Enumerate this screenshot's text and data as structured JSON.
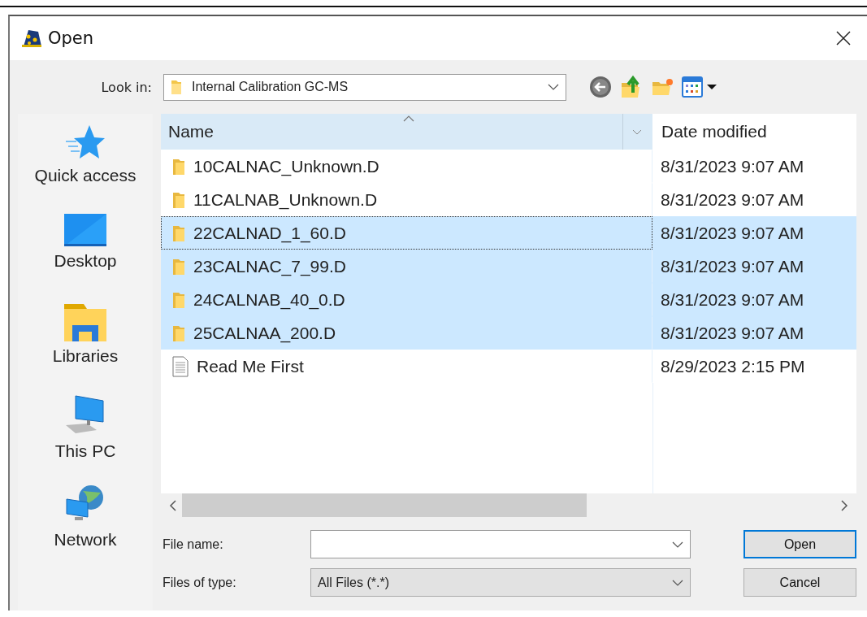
{
  "window": {
    "title": "Open"
  },
  "look_in": {
    "label": "Look in:",
    "value": "Internal Calibration GC-MS"
  },
  "places": [
    {
      "kind": "quick",
      "label": "Quick access"
    },
    {
      "kind": "desktop",
      "label": "Desktop"
    },
    {
      "kind": "libraries",
      "label": "Libraries"
    },
    {
      "kind": "pc",
      "label": "This PC"
    },
    {
      "kind": "network",
      "label": "Network"
    }
  ],
  "columns": [
    {
      "label": "Name"
    },
    {
      "label": "Date modified"
    }
  ],
  "files": [
    {
      "kind": "folder",
      "name": "10CALNAC_Unknown.D",
      "date": "8/31/2023 9:07 AM",
      "selected": false,
      "focused": false
    },
    {
      "kind": "folder",
      "name": "11CALNAB_Unknown.D",
      "date": "8/31/2023 9:07 AM",
      "selected": false,
      "focused": false
    },
    {
      "kind": "folder",
      "name": "22CALNAD_1_60.D",
      "date": "8/31/2023 9:07 AM",
      "selected": true,
      "focused": true
    },
    {
      "kind": "folder",
      "name": "23CALNAC_7_99.D",
      "date": "8/31/2023 9:07 AM",
      "selected": true,
      "focused": false
    },
    {
      "kind": "folder",
      "name": "24CALNAB_40_0.D",
      "date": "8/31/2023 9:07 AM",
      "selected": true,
      "focused": false
    },
    {
      "kind": "folder",
      "name": "25CALNAA_200.D",
      "date": "8/31/2023 9:07 AM",
      "selected": true,
      "focused": false
    },
    {
      "kind": "document",
      "name": "Read Me First",
      "date": "8/29/2023 2:15 PM",
      "selected": false,
      "focused": false
    }
  ],
  "file_name": {
    "label": "File name:"
  },
  "file_type": {
    "label": "Files of type:",
    "value": "All Files (*.*)"
  },
  "buttons": [
    {
      "label": "Open",
      "default": true
    },
    {
      "label": "Cancel",
      "default": false
    }
  ]
}
